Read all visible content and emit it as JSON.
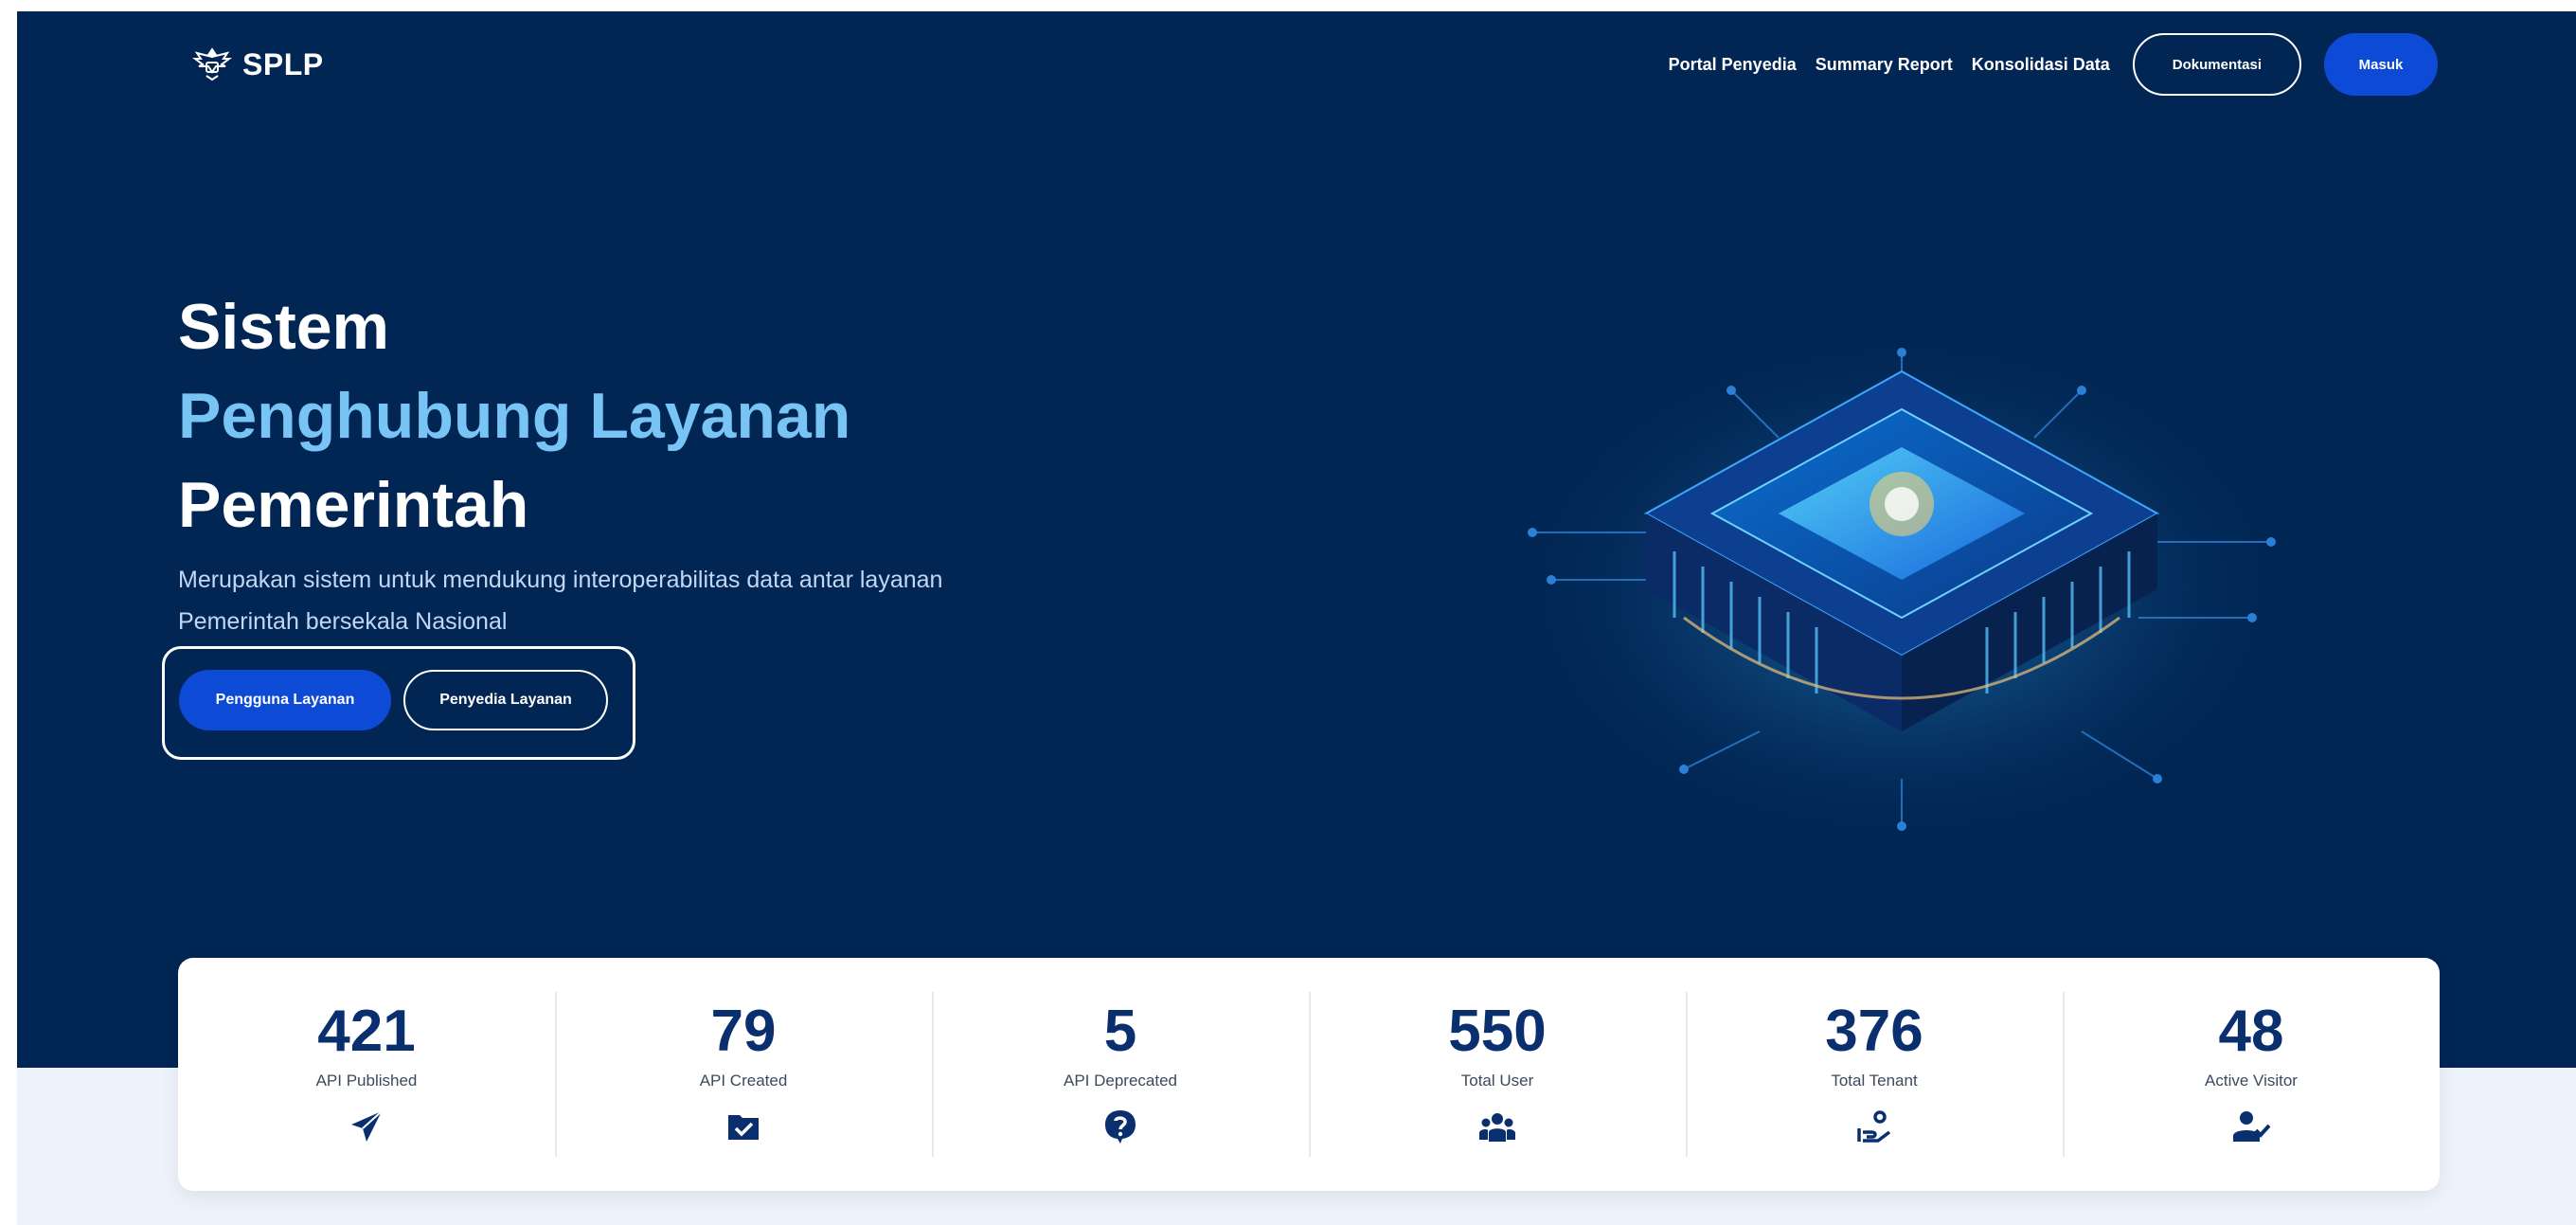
{
  "header": {
    "brand": "SPLP",
    "nav": {
      "portal_penyedia": "Portal Penyedia",
      "summary_report": "Summary Report",
      "konsolidasi_data": "Konsolidasi Data",
      "dokumentasi": "Dokumentasi",
      "masuk": "Masuk"
    }
  },
  "hero": {
    "title_line1": "Sistem",
    "title_line2": "Penghubung Layanan",
    "title_line3": "Pemerintah",
    "subtitle": "Merupakan sistem untuk mendukung interoperabilitas data antar layanan Pemerintah bersekala Nasional",
    "cta_primary": "Pengguna Layanan",
    "cta_secondary": "Penyedia Layanan"
  },
  "stats": [
    {
      "value": "421",
      "label": "API Published",
      "icon": "paper-plane-icon"
    },
    {
      "value": "79",
      "label": "API Created",
      "icon": "folder-check-icon"
    },
    {
      "value": "5",
      "label": "API Deprecated",
      "icon": "question-bubble-icon"
    },
    {
      "value": "550",
      "label": "Total User",
      "icon": "users-icon"
    },
    {
      "value": "376",
      "label": "Total Tenant",
      "icon": "hand-holding-user-icon"
    },
    {
      "value": "48",
      "label": "Active Visitor",
      "icon": "user-check-icon"
    }
  ],
  "colors": {
    "hero_bg": "#012654",
    "accent_blue": "#0d4bd6",
    "title_highlight": "#78c4f5",
    "stat_number": "#0a2f6e",
    "lower_bg": "#eef2fb"
  }
}
